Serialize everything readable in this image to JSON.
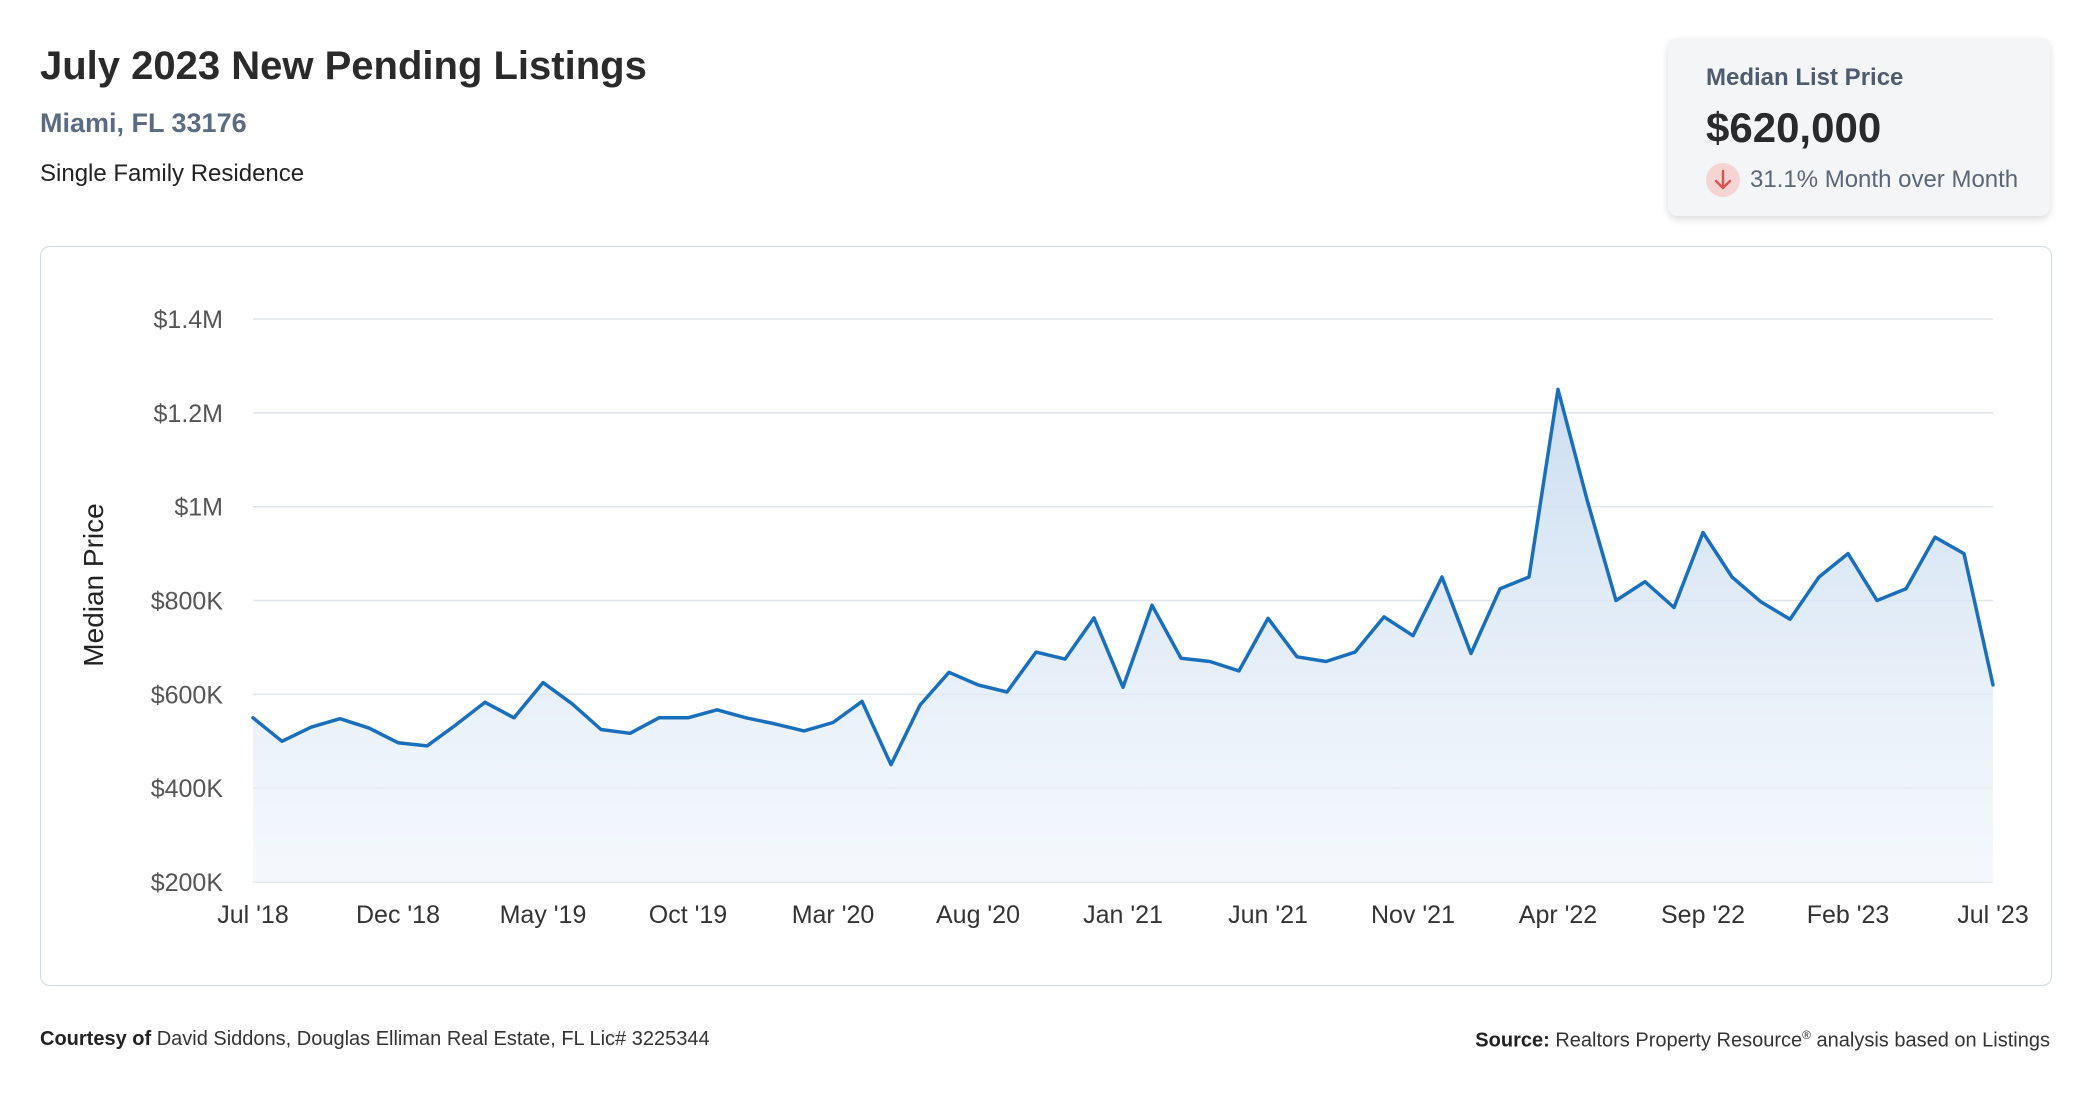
{
  "header": {
    "title": "July 2023 New Pending Listings",
    "location": "Miami, FL 33176",
    "property_type": "Single Family Residence"
  },
  "stat_card": {
    "label": "Median List Price",
    "value": "$620,000",
    "change": "31.1% Month over Month",
    "direction": "down",
    "icon": "arrow-down-icon",
    "change_color": "#d9534f"
  },
  "footer": {
    "courtesy_label": "Courtesy of",
    "courtesy_text": "David Siddons, Douglas Elliman Real Estate, FL Lic# 3225344",
    "source_label": "Source:",
    "source_text_1": "Realtors Property Resource",
    "source_mark": "®",
    "source_text_2": "analysis based on Listings"
  },
  "chart_data": {
    "type": "area",
    "ylabel": "Median Price",
    "ylim": [
      200000,
      1400000
    ],
    "y_ticks": [
      {
        "value": 1400000,
        "label": "$1.4M"
      },
      {
        "value": 1200000,
        "label": "$1.2M"
      },
      {
        "value": 1000000,
        "label": "$1M"
      },
      {
        "value": 800000,
        "label": "$800K"
      },
      {
        "value": 600000,
        "label": "$600K"
      },
      {
        "value": 400000,
        "label": "$400K"
      },
      {
        "value": 200000,
        "label": "$200K"
      }
    ],
    "x_ticks": [
      {
        "index": 0,
        "label": "Jul '18"
      },
      {
        "index": 5,
        "label": "Dec '18"
      },
      {
        "index": 10,
        "label": "May '19"
      },
      {
        "index": 15,
        "label": "Oct '19"
      },
      {
        "index": 20,
        "label": "Mar '20"
      },
      {
        "index": 25,
        "label": "Aug '20"
      },
      {
        "index": 30,
        "label": "Jan '21"
      },
      {
        "index": 35,
        "label": "Jun '21"
      },
      {
        "index": 40,
        "label": "Nov '21"
      },
      {
        "index": 45,
        "label": "Apr '22"
      },
      {
        "index": 50,
        "label": "Sep '22"
      },
      {
        "index": 55,
        "label": "Feb '23"
      },
      {
        "index": 60,
        "label": "Jul '23"
      }
    ],
    "line_color": "#1a6fbd",
    "fill_color": "#c9dcf0",
    "grid": true,
    "series": [
      {
        "x": [
          "2018-07",
          "2018-08",
          "2018-09",
          "2018-10",
          "2018-11",
          "2018-12",
          "2019-01",
          "2019-02",
          "2019-03",
          "2019-04",
          "2019-05",
          "2019-06",
          "2019-07",
          "2019-08",
          "2019-09",
          "2019-10",
          "2019-11",
          "2019-12",
          "2020-01",
          "2020-02",
          "2020-03",
          "2020-04",
          "2020-05",
          "2020-06",
          "2020-07",
          "2020-08",
          "2020-09",
          "2020-10",
          "2020-11",
          "2020-12",
          "2021-01",
          "2021-02",
          "2021-03",
          "2021-04",
          "2021-05",
          "2021-06",
          "2021-07",
          "2021-08",
          "2021-09",
          "2021-10",
          "2021-11",
          "2021-12",
          "2022-01",
          "2022-02",
          "2022-03",
          "2022-04",
          "2022-05",
          "2022-06",
          "2022-07",
          "2022-08",
          "2022-09",
          "2022-10",
          "2022-11",
          "2022-12",
          "2023-01",
          "2023-02",
          "2023-03",
          "2023-04",
          "2023-05",
          "2023-06",
          "2023-07"
        ],
        "values": [
          550000,
          500000,
          530000,
          548000,
          528000,
          497000,
          490000,
          535000,
          583000,
          550000,
          625000,
          580000,
          525000,
          517000,
          550000,
          550000,
          567000,
          550000,
          537000,
          522000,
          540000,
          585000,
          450000,
          577000,
          647000,
          620000,
          605000,
          690000,
          675000,
          763000,
          615000,
          790000,
          677000,
          670000,
          650000,
          762000,
          680000,
          670000,
          690000,
          765000,
          725000,
          850000,
          687000,
          825000,
          850000,
          1250000,
          1015000,
          800000,
          840000,
          785000,
          945000,
          850000,
          797000,
          760000,
          850000,
          900000,
          800000,
          825000,
          935000,
          900000,
          620000
        ]
      }
    ]
  }
}
